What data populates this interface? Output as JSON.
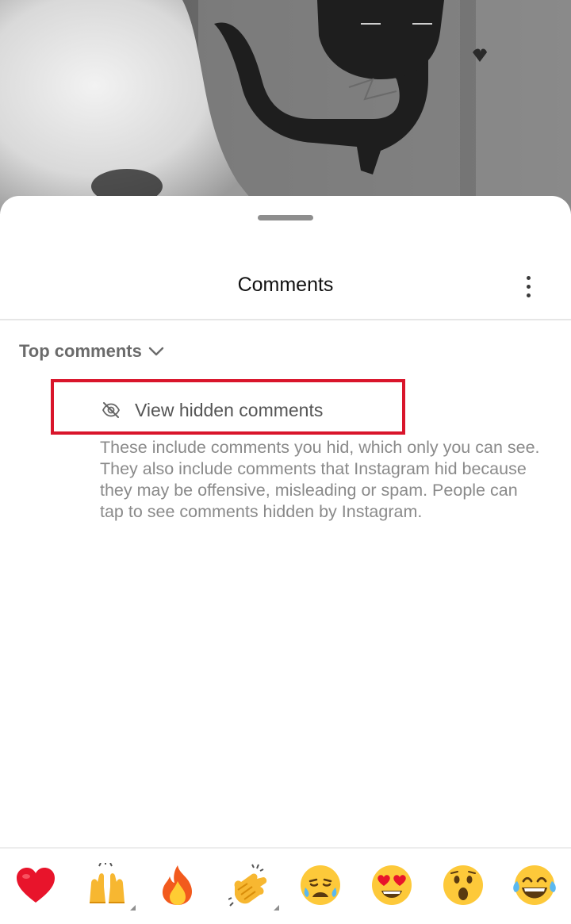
{
  "sheet": {
    "title": "Comments",
    "sort_label": "Top comments",
    "hidden_link_label": "View hidden comments",
    "hidden_description": "These include comments you hid, which only you can see. They also include comments that Instagram hid because they may be offensive, misleading or spam. People can tap to see comments hidden by Instagram."
  },
  "icons": {
    "more": "more-vertical-icon",
    "sort": "chevron-down-icon",
    "hidden": "eye-off-icon"
  },
  "highlight_color": "#d9152b",
  "reactions": [
    {
      "name": "red-heart",
      "has_variants": false
    },
    {
      "name": "raising-hands",
      "has_variants": true
    },
    {
      "name": "fire",
      "has_variants": false
    },
    {
      "name": "clapping-hands",
      "has_variants": true
    },
    {
      "name": "crying-face",
      "has_variants": false
    },
    {
      "name": "heart-eyes-face",
      "has_variants": false
    },
    {
      "name": "astonished-face",
      "has_variants": false
    },
    {
      "name": "tears-of-joy-face",
      "has_variants": false
    }
  ]
}
